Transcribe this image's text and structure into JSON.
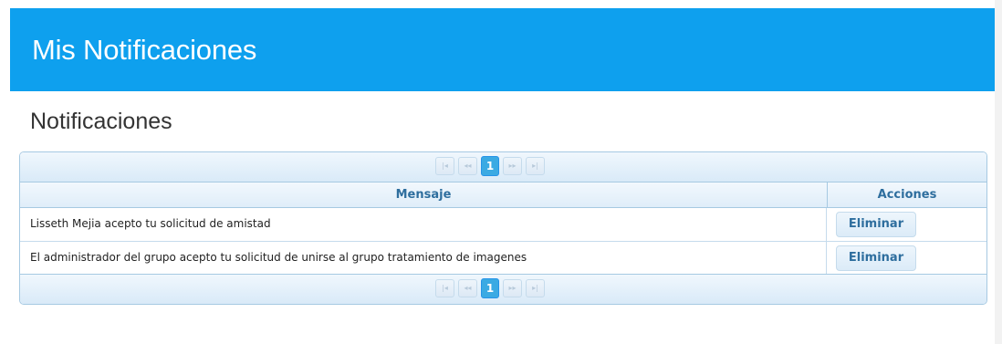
{
  "header": {
    "title": "Mis Notificaciones"
  },
  "section": {
    "title": "Notificaciones"
  },
  "paginator": {
    "first_icon": "first-page-icon",
    "prev_icon": "previous-page-icon",
    "next_icon": "next-page-icon",
    "last_icon": "last-page-icon",
    "first_glyph": "|◂",
    "prev_glyph": "◂◂",
    "next_glyph": "▸▸",
    "last_glyph": "▸|",
    "current_page": "1"
  },
  "table": {
    "columns": [
      "Mensaje",
      "Acciones"
    ],
    "rows": [
      {
        "message": "Lisseth Mejia acepto tu solicitud de amistad",
        "action": "Eliminar"
      },
      {
        "message": "El administrador del grupo acepto tu solicitud de unirse al grupo tratamiento de imagenes",
        "action": "Eliminar"
      }
    ]
  },
  "colors": {
    "header_bg": "#0ea0ee",
    "table_border": "#a6c9e2",
    "header_text": "#2e6e9e",
    "active_page": "#3baae3"
  }
}
